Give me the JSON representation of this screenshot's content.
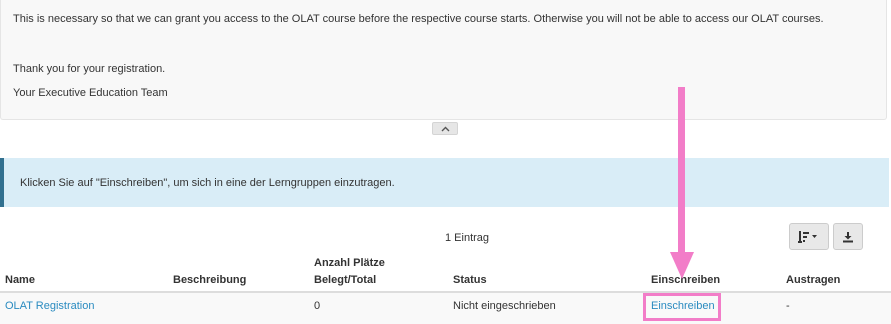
{
  "message": {
    "lines": [
      "This is necessary so that we can grant you access to the OLAT course before the respective course starts. Otherwise you will not be able to access our OLAT courses.",
      "Thank you for your registration.",
      "Your Executive Education Team"
    ]
  },
  "info": {
    "text": "Klicken Sie auf \"Einschreiben\", um sich in eine der Lerngruppen einzutragen."
  },
  "table": {
    "count": "1 Eintrag",
    "headers": {
      "name": "Name",
      "beschreibung": "Beschreibung",
      "anzahl_line1": "Anzahl Plätze",
      "anzahl_line2": "Belegt/Total",
      "status": "Status",
      "einschreiben": "Einschreiben",
      "austragen": "Austragen"
    },
    "rows": [
      {
        "name": "OLAT Registration",
        "beschreibung": "",
        "anzahl": "0",
        "status": "Nicht eingeschrieben",
        "einschreiben": "Einschreiben",
        "austragen": "-"
      }
    ]
  },
  "icons": {
    "collapse": "chevron-up-icon",
    "sort": "sort-icon",
    "download": "download-icon"
  },
  "colors": {
    "link": "#2a8bc0",
    "info_bg": "#d9edf7",
    "info_border": "#31708f",
    "annotation": "#f27dc8"
  }
}
